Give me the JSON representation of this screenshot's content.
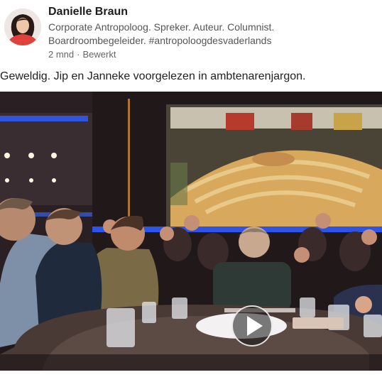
{
  "post": {
    "author": {
      "name": "Danielle Braun",
      "headline_line1": "Corporate Antropoloog. Spreker. Auteur. Columnist.",
      "headline_line2": "Boardroombegeleider. #antropoloogdesvaderlands",
      "age": "2 mnd",
      "separator": "·",
      "edited": "Bewerkt"
    },
    "text": "Geweldig. Jip en Janneke voorgelezen in ambtenarenjargon.",
    "video": {
      "play_icon": "play-icon",
      "scene": "talk-show-studio-with-parliament-screen"
    }
  },
  "colors": {
    "studio_blue": "#2f5bff",
    "background": "#ffffff",
    "avatar_red": "#e0413a"
  }
}
